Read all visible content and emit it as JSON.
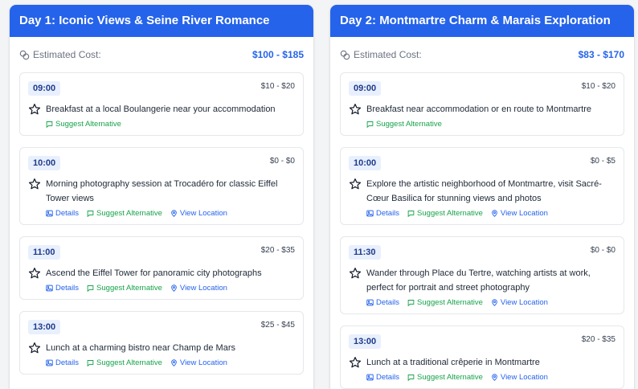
{
  "days": [
    {
      "title": "Day 1: Iconic Views & Seine River Romance",
      "cost_label": "Estimated Cost:",
      "cost_value": "$100 - $185",
      "activities": [
        {
          "time": "09:00",
          "cost": "$10 - $20",
          "desc": "Breakfast at a local Boulangerie near your accommodation",
          "details": null,
          "suggest": "Suggest Alternative",
          "location": null
        },
        {
          "time": "10:00",
          "cost": "$0 - $0",
          "desc": "Morning photography session at Trocadéro for classic Eiffel Tower views",
          "details": "Details",
          "suggest": "Suggest Alternative",
          "location": "View Location"
        },
        {
          "time": "11:00",
          "cost": "$20 - $35",
          "desc": "Ascend the Eiffel Tower for panoramic city photographs",
          "details": "Details",
          "suggest": "Suggest Alternative",
          "location": "View Location"
        },
        {
          "time": "13:00",
          "cost": "$25 - $45",
          "desc": "Lunch at a charming bistro near Champ de Mars",
          "details": "Details",
          "suggest": "Suggest Alternative",
          "location": "View Location"
        }
      ]
    },
    {
      "title": "Day 2: Montmartre Charm & Marais Exploration",
      "cost_label": "Estimated Cost:",
      "cost_value": "$83 - $170",
      "activities": [
        {
          "time": "09:00",
          "cost": "$10 - $20",
          "desc": "Breakfast near accommodation or en route to Montmartre",
          "details": null,
          "suggest": "Suggest Alternative",
          "location": null
        },
        {
          "time": "10:00",
          "cost": "$0 - $5",
          "desc": "Explore the artistic neighborhood of Montmartre, visit Sacré-Cœur Basilica for stunning views and photos",
          "details": "Details",
          "suggest": "Suggest Alternative",
          "location": "View Location"
        },
        {
          "time": "11:30",
          "cost": "$0 - $0",
          "desc": "Wander through Place du Tertre, watching artists at work, perfect for portrait and street photography",
          "details": "Details",
          "suggest": "Suggest Alternative",
          "location": "View Location"
        },
        {
          "time": "13:00",
          "cost": "$20 - $35",
          "desc": "Lunch at a traditional crêperie in Montmartre",
          "details": "Details",
          "suggest": "Suggest Alternative",
          "location": "View Location"
        }
      ]
    }
  ],
  "icons": {
    "cost": "coins-icon",
    "favorite": "star-icon",
    "details": "image-icon",
    "suggest": "message-icon",
    "location": "map-pin-icon"
  },
  "colors": {
    "header_bg": "#2563eb",
    "accent_blue": "#2563eb",
    "suggest_green": "#16a34a",
    "badge_bg": "#e8effd"
  }
}
